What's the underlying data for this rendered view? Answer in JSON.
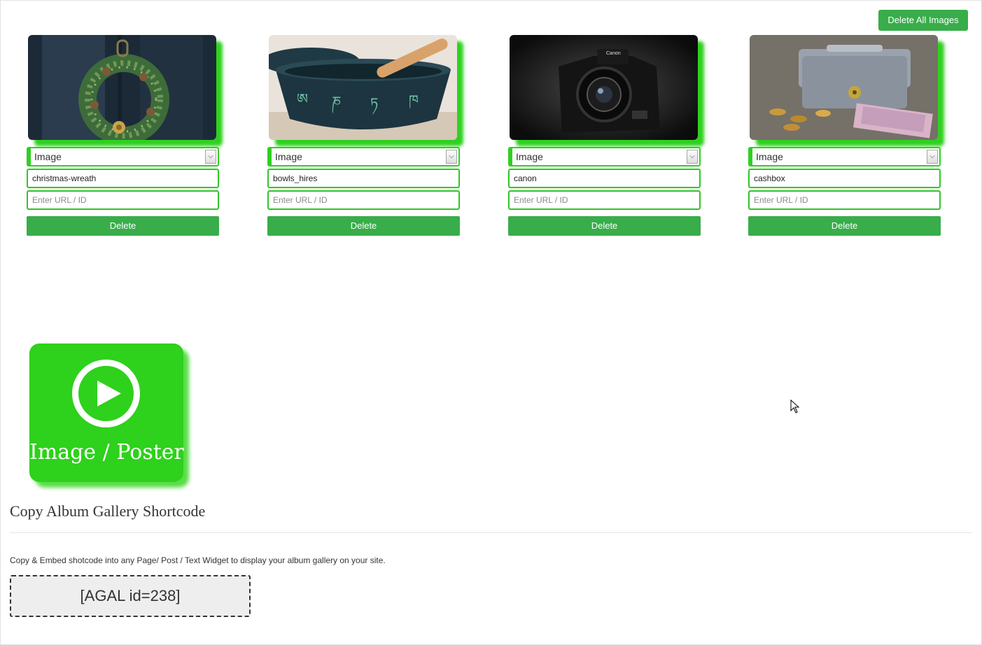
{
  "toolbar": {
    "delete_all_label": "Delete All Images"
  },
  "images": [
    {
      "thumb_icon": "christmas-wreath-photo",
      "type_value": "Image",
      "name_value": "christmas-wreath",
      "url_placeholder": "Enter URL / ID",
      "delete_label": "Delete"
    },
    {
      "thumb_icon": "singing-bowl-photo",
      "type_value": "Image",
      "name_value": "bowls_hires",
      "url_placeholder": "Enter URL / ID",
      "delete_label": "Delete"
    },
    {
      "thumb_icon": "canon-camera-photo",
      "type_value": "Image",
      "name_value": "canon",
      "url_placeholder": "Enter URL / ID",
      "delete_label": "Delete"
    },
    {
      "thumb_icon": "cashbox-photo",
      "type_value": "Image",
      "name_value": "cashbox",
      "url_placeholder": "Enter URL / ID",
      "delete_label": "Delete"
    }
  ],
  "poster": {
    "label": "Image / Poster",
    "icon": "play-circle-icon"
  },
  "shortcode_section": {
    "heading": "Copy Album Gallery Shortcode",
    "description": "Copy & Embed shotcode into any Page/ Post / Text Widget to display your album gallery on your site.",
    "shortcode": "[AGAL id=238]"
  },
  "colors": {
    "accent_green": "#38ad4a",
    "bright_green": "#2ed11b"
  }
}
